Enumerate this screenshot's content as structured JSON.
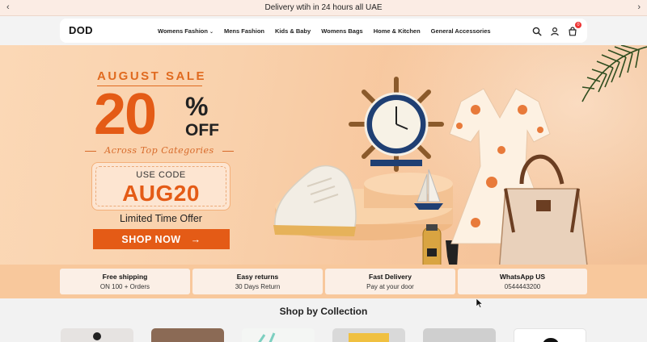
{
  "announcement": {
    "text": "Delivery wtih in 24 hours all UAE"
  },
  "header": {
    "logo": "DOD",
    "menu": [
      {
        "label": "Womens Fashion",
        "has_dropdown": true
      },
      {
        "label": "Mens Fashion"
      },
      {
        "label": "Kids & Baby"
      },
      {
        "label": "Womens Bags"
      },
      {
        "label": "Home & Kitchen"
      },
      {
        "label": "General Accessories"
      }
    ],
    "icons": [
      "search-icon",
      "account-icon",
      "cart-icon"
    ],
    "cart_count": "0"
  },
  "hero": {
    "sale_title": "AUGUST SALE",
    "discount": "20",
    "percent_sign": "%",
    "off": "OFF",
    "subline": "Across Top Categories",
    "use_code": "USE CODE",
    "code": "AUG20",
    "limited": "Limited Time Offer",
    "cta": "SHOP NOW",
    "cta_arrow": "→"
  },
  "features": [
    {
      "title": "Free shipping",
      "sub": "ON 100 + Orders"
    },
    {
      "title": "Easy returns",
      "sub": "30 Days Return"
    },
    {
      "title": "Fast Delivery",
      "sub": "Pay at your door"
    },
    {
      "title": "WhatsApp US",
      "sub": "0544443200"
    }
  ],
  "collections": {
    "title": "Shop by Collection"
  },
  "colors": {
    "accent": "#e45b16",
    "hero_bg": "#f9d1ac",
    "band": "#f8c89c"
  }
}
